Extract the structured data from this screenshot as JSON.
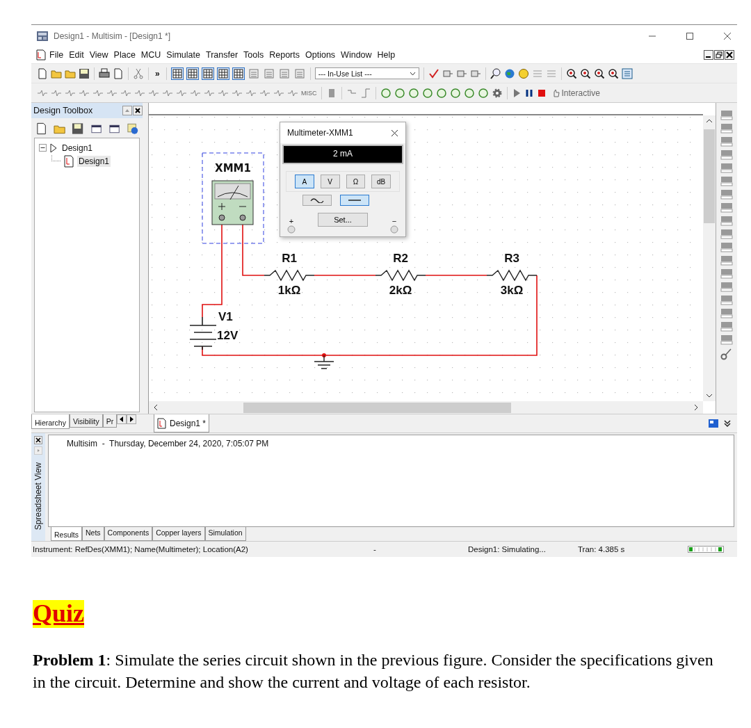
{
  "window": {
    "title": "Design1 - Multisim - [Design1 *]"
  },
  "menu": [
    {
      "label": "File"
    },
    {
      "label": "Edit"
    },
    {
      "label": "View"
    },
    {
      "label": "Place"
    },
    {
      "label": "MCU"
    },
    {
      "label": "Simulate"
    },
    {
      "label": "Transfer"
    },
    {
      "label": "Tools"
    },
    {
      "label": "Reports"
    },
    {
      "label": "Options"
    },
    {
      "label": "Window"
    },
    {
      "label": "Help"
    }
  ],
  "toolbar": {
    "more": "»",
    "in_use_list": "--- In-Use List ---"
  },
  "components_toolbar": {
    "misc_label": "MISC",
    "mode": "Interactive"
  },
  "design_toolbox": {
    "title": "Design Toolbox",
    "tree": [
      {
        "label": "Design1",
        "expanded": true,
        "children": [
          {
            "label": "Design1",
            "selected": true
          }
        ]
      }
    ],
    "tabs": [
      {
        "label": "Hierarchy",
        "selected": true
      },
      {
        "label": "Visibility",
        "selected": false
      },
      {
        "label": "Pr",
        "selected": false
      }
    ]
  },
  "document_tabs": [
    {
      "label": "Design1 *",
      "selected": true
    }
  ],
  "schematic": {
    "instrument": "XMM1",
    "source": {
      "ref": "V1",
      "value": "12V"
    },
    "resistors": [
      {
        "ref": "R1",
        "value": "1kΩ"
      },
      {
        "ref": "R2",
        "value": "2kΩ"
      },
      {
        "ref": "R3",
        "value": "3kΩ"
      }
    ]
  },
  "multimeter": {
    "title": "Multimeter-XMM1",
    "reading": "2 mA",
    "modes": [
      {
        "label": "A",
        "selected": true
      },
      {
        "label": "V",
        "selected": false
      },
      {
        "label": "Ω",
        "selected": false
      },
      {
        "label": "dB",
        "selected": false
      }
    ],
    "signals": [
      {
        "kind": "ac",
        "selected": false
      },
      {
        "kind": "dc",
        "selected": true
      }
    ],
    "plus": "+",
    "minus": "−",
    "set_button": "Set..."
  },
  "spreadsheet": {
    "label": "Spreadsheet View",
    "log": "Multisim  -  Thursday, December 24, 2020, 7:05:07 PM",
    "tabs": [
      {
        "label": "Results",
        "selected": true
      },
      {
        "label": "Nets",
        "selected": false
      },
      {
        "label": "Components",
        "selected": false
      },
      {
        "label": "Copper layers",
        "selected": false
      },
      {
        "label": "Simulation",
        "selected": false
      }
    ]
  },
  "status_bar": {
    "instrument": "Instrument: RefDes(XMM1); Name(Multimeter); Location(A2)",
    "separator": "-",
    "design": "Design1: Simulating...",
    "tran": "Tran: 4.385 s"
  },
  "quiz": {
    "heading": "Quiz",
    "problem": "**Problem 1**: Simulate the series circuit shown in the previous figure. Consider the specifications given in the circuit. Determine and show the current and voltage of each resistor."
  }
}
